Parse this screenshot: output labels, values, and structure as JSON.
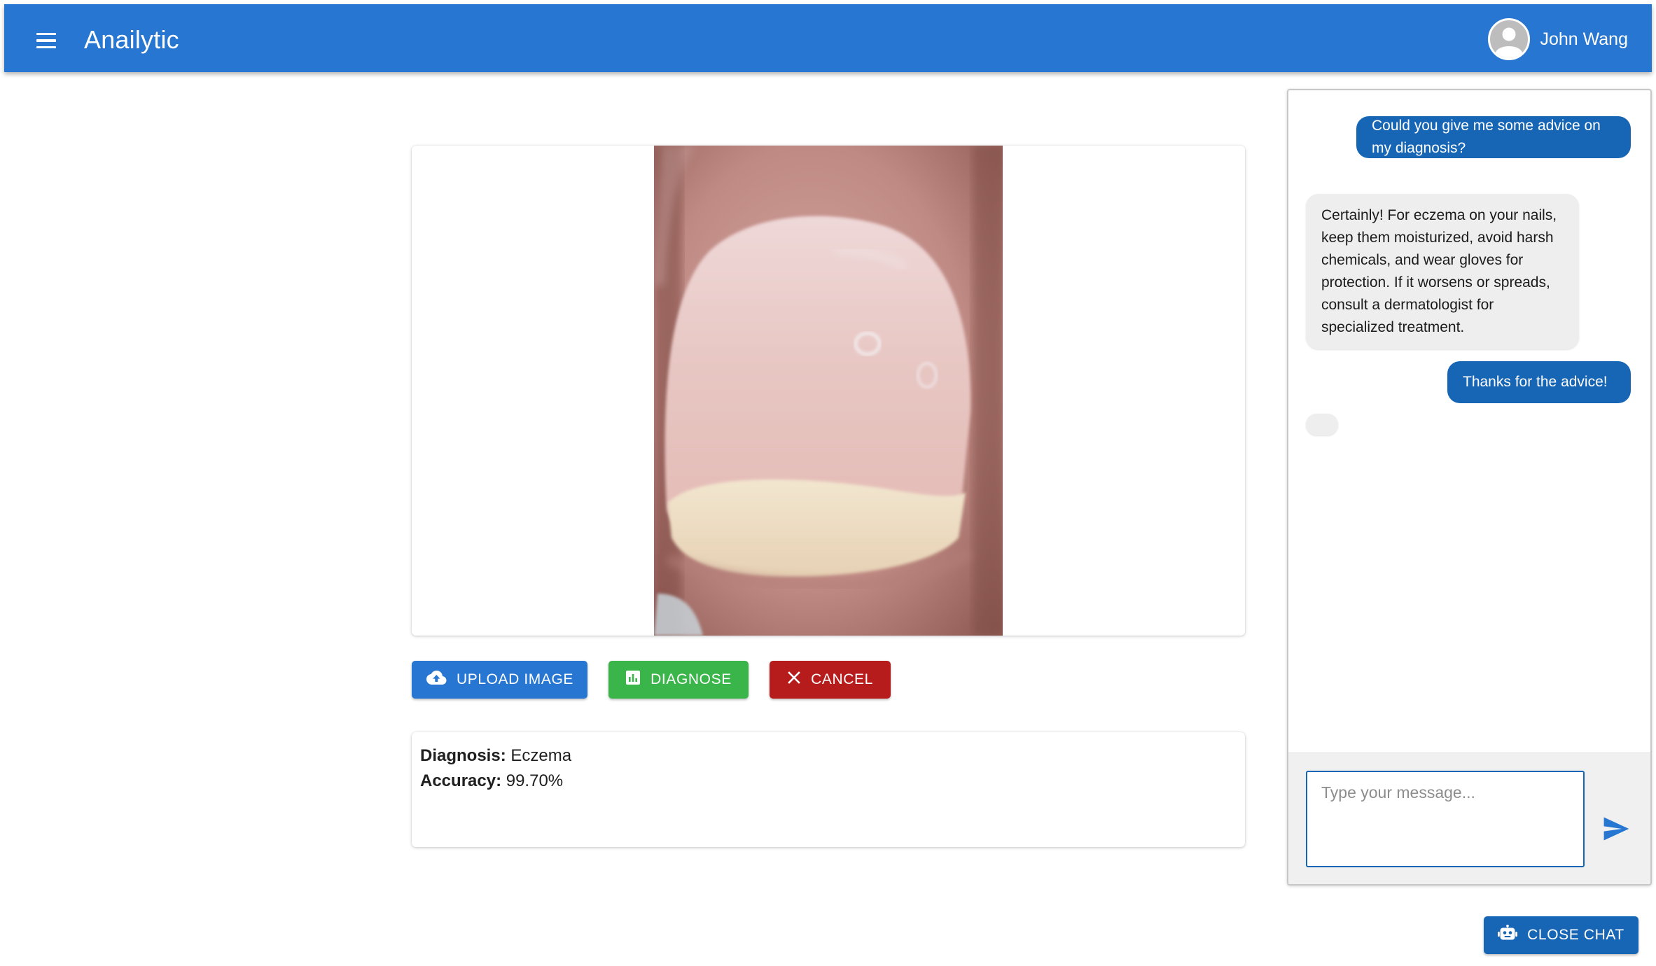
{
  "app": {
    "title": "Anailytic",
    "brand_color": "#2676d2"
  },
  "user": {
    "name": "John Wang"
  },
  "actions": {
    "upload_label": "UPLOAD IMAGE",
    "diagnose_label": "DIAGNOSE",
    "cancel_label": "CANCEL",
    "upload_color": "#2676d2",
    "diagnose_color": "#39b54a",
    "cancel_color": "#b71c1c"
  },
  "result": {
    "diagnosis_label": "Diagnosis:",
    "diagnosis_value": "Eczema",
    "accuracy_label": "Accuracy:",
    "accuracy_value": "99.70%"
  },
  "chat": {
    "messages": [
      {
        "sender": "user",
        "text": "Could you give me some advice on my diagnosis?"
      },
      {
        "sender": "bot",
        "text": "Certainly! For eczema on your nails, keep them moisturized, avoid harsh chemicals, and wear gloves for protection. If it worsens or spreads, consult a dermatologist for specialized treatment."
      },
      {
        "sender": "user",
        "text": "Thanks for the advice!"
      }
    ],
    "input_placeholder": "Type your message...",
    "close_label": "CLOSE CHAT",
    "user_bubble_color": "#1766b5",
    "bot_bubble_color": "#eeeeee"
  },
  "icons": {
    "menu": "menu-icon",
    "avatar": "person-icon",
    "upload": "cloud-upload-icon",
    "diagnose": "chart-icon",
    "cancel": "close-icon",
    "send": "send-icon",
    "chat": "robot-icon"
  }
}
